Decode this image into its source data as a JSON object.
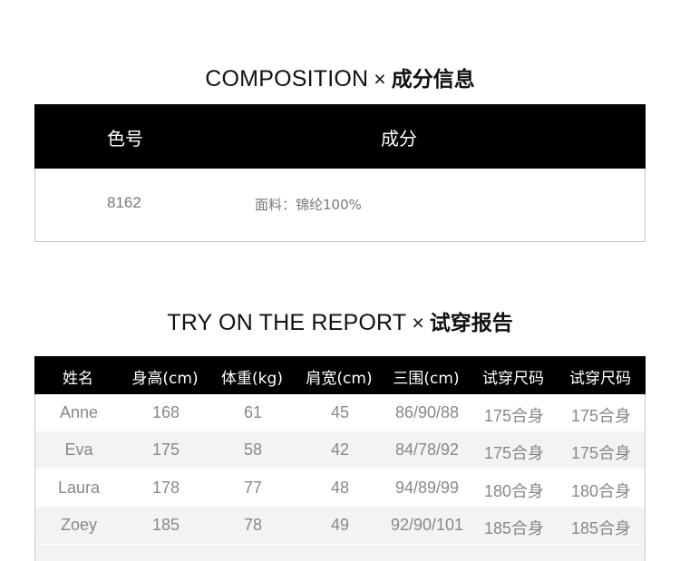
{
  "composition": {
    "title_en": "COMPOSITION",
    "separator": "×",
    "title_zh": "成分信息",
    "headers": [
      "色号",
      "成分"
    ],
    "rows": [
      {
        "code": "8162",
        "material": "面料：锦纶100%"
      }
    ]
  },
  "tryon": {
    "title_en": "TRY ON THE REPORT",
    "separator": "×",
    "title_zh": "试穿报告",
    "headers": [
      "姓名",
      "身高(cm)",
      "体重(kg)",
      "肩宽(cm)",
      "三围(cm)",
      "试穿尺码",
      "试穿尺码"
    ],
    "rows": [
      [
        "Anne",
        "168",
        "61",
        "45",
        "86/90/88",
        "175合身",
        "175合身"
      ],
      [
        "Eva",
        "175",
        "58",
        "42",
        "84/78/92",
        "175合身",
        "175合身"
      ],
      [
        "Laura",
        "178",
        "77",
        "48",
        "94/89/99",
        "180合身",
        "180合身"
      ],
      [
        "Zoey",
        "185",
        "78",
        "49",
        "92/90/101",
        "185合身",
        "185合身"
      ]
    ]
  },
  "colors": {
    "header_bg": "#000000",
    "header_text": "#ffffff",
    "body_text": "#888888",
    "alt_row": "#f3f3f3",
    "border": "#c8c8c8"
  }
}
